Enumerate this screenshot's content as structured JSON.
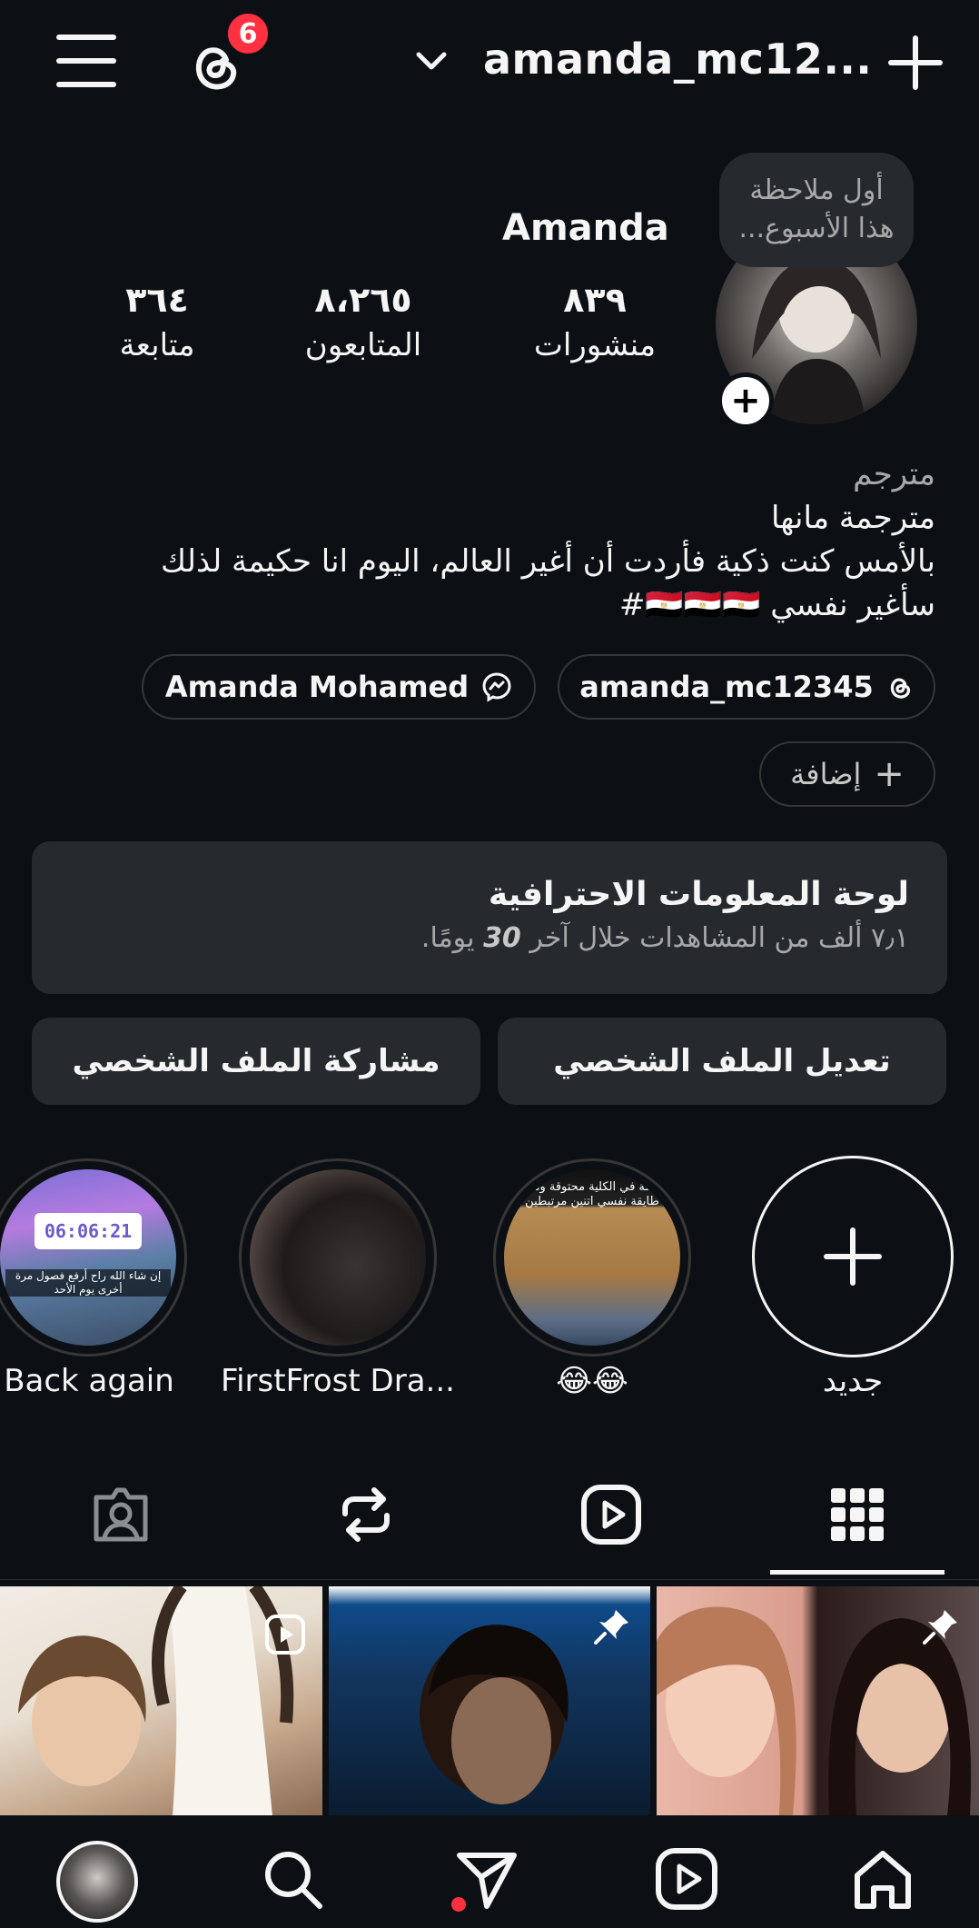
{
  "header": {
    "threads_badge": "6",
    "username": "amanda_mc12..."
  },
  "profile": {
    "note_line1": "أول ملاحظة",
    "note_line2": "هذا الأسبوع...",
    "display_name": "Amanda",
    "stats": {
      "posts_count": "٨٣٩",
      "posts_label": "منشورات",
      "followers_count": "٨،٢٦٥",
      "followers_label": "المتابعون",
      "following_count": "٣٦٤",
      "following_label": "متابعة"
    },
    "bio": {
      "category": "مترجم",
      "line1": "مترجمة مانها",
      "line2": "بالأمس كنت ذكية فأردت أن أغير العالم، اليوم انا حكيمة لذلك",
      "line3": "سأغير نفسي 🇪🇬🇪🇬🇪🇬#"
    },
    "links": {
      "threads_handle": "amanda_mc12345",
      "facebook_name": "Amanda Mohamed",
      "add_label": "إضافة"
    }
  },
  "dashboard": {
    "title": "لوحة المعلومات الاحترافية",
    "subtitle_prefix": "٧٫١ ألف من المشاهدات خلال آخر",
    "subtitle_days": "30",
    "subtitle_suffix": "يومًا."
  },
  "buttons": {
    "edit_profile": "تعديل الملف الشخصي",
    "share_profile": "مشاركة الملف الشخصي"
  },
  "highlights": [
    {
      "label": "جديد"
    },
    {
      "label": "😂😂"
    },
    {
      "label": "FirstFrost Dra..."
    },
    {
      "label": "Back again"
    }
  ],
  "highlight_texts": {
    "h1_caption": "واقفة في الكلية محتوقة ومش طايقة نفسي اتنين مرتبطين",
    "h3_timer": "06:06:21",
    "h3_caption": "إن شاء الله راح أرفع فصول مرة أخرى يوم الأحد"
  },
  "tabs": [
    "grid",
    "reels",
    "reposts",
    "tagged"
  ],
  "colors": {
    "background": "#0c1014",
    "surface": "#262a2f",
    "badge": "#ff3040",
    "text": "#f5f5f5",
    "muted": "#a8a8a8"
  },
  "icons": {
    "menu": "hamburger-icon",
    "threads": "threads-icon",
    "create": "plus-icon",
    "nav": [
      "home-icon",
      "reels-icon",
      "direct-send-icon",
      "search-icon",
      "profile-avatar"
    ]
  }
}
